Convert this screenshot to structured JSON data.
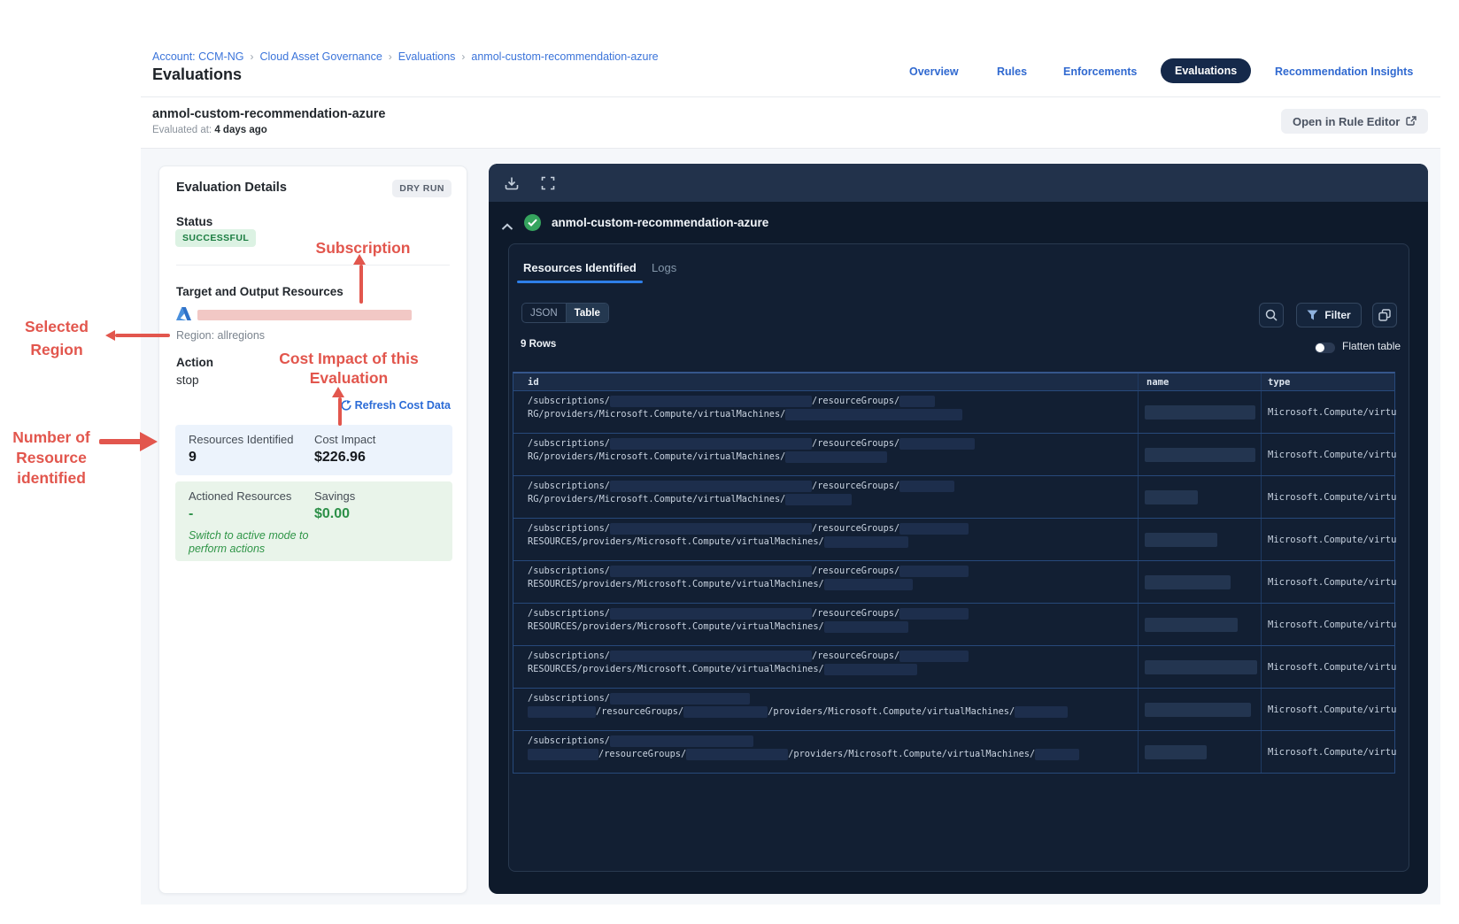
{
  "breadcrumb": {
    "items": [
      "Account: CCM-NG",
      "Cloud Asset Governance",
      "Evaluations",
      "anmol-custom-recommendation-azure"
    ],
    "separator": "›"
  },
  "page_title": "Evaluations",
  "nav": {
    "items": [
      {
        "label": "Overview"
      },
      {
        "label": "Rules"
      },
      {
        "label": "Enforcements"
      },
      {
        "label": "Evaluations",
        "active": true
      },
      {
        "label": "Recommendation Insights"
      }
    ]
  },
  "subheader": {
    "title": "anmol-custom-recommendation-azure",
    "evaluated_label": "Evaluated at:",
    "evaluated_value": "4 days ago",
    "open_button": "Open in Rule Editor"
  },
  "details": {
    "title": "Evaluation Details",
    "mode_badge": "DRY RUN",
    "status_label": "Status",
    "status_value": "SUCCESSFUL",
    "target_label": "Target and Output Resources",
    "region": "Region: allregions",
    "action_label": "Action",
    "action_value": "stop",
    "refresh_link": "Refresh Cost Data",
    "resources_identified_label": "Resources Identified",
    "resources_identified_value": "9",
    "cost_impact_label": "Cost Impact",
    "cost_impact_value": "$226.96",
    "actioned_label": "Actioned Resources",
    "actioned_value": "-",
    "savings_label": "Savings",
    "savings_value": "$0.00",
    "switch_note_line1": "Switch to active mode to",
    "switch_note_line2": "perform actions"
  },
  "annotations": {
    "color": "#e2564d",
    "subscription": "Subscription",
    "selected_region_line1": "Selected",
    "selected_region_line2": "Region",
    "cost_impact_line1": "Cost Impact of this",
    "cost_impact_line2": "Evaluation",
    "resources_line1": "Number of",
    "resources_line2": "Resource",
    "resources_line3": "identified"
  },
  "panel": {
    "title": "anmol-custom-recommendation-azure",
    "tabs": [
      {
        "label": "Resources Identified",
        "active": true
      },
      {
        "label": "Logs"
      }
    ],
    "view_toggle": {
      "json": "JSON",
      "table": "Table",
      "active": "Table"
    },
    "filter_label": "Filter",
    "rows_count": "9 Rows",
    "flatten_label": "Flatten table",
    "table": {
      "columns": [
        "id",
        "name",
        "type"
      ],
      "rows": [
        {
          "line1": [
            {
              "t": "/subscriptions/"
            },
            {
              "b": 228
            },
            {
              "t": "/resourceGroups/"
            },
            {
              "b": 40
            }
          ],
          "line2": [
            {
              "t": "RG/providers/Microsoft.Compute/virtualMachines/"
            },
            {
              "b": 200
            }
          ],
          "name_bar": 125,
          "type": "Microsoft.Compute/virtu"
        },
        {
          "line1": [
            {
              "t": "/subscriptions/"
            },
            {
              "b": 228
            },
            {
              "t": "/resourceGroups/"
            },
            {
              "b": 85
            }
          ],
          "line2": [
            {
              "t": "RG/providers/Microsoft.Compute/virtualMachines/"
            },
            {
              "b": 115
            }
          ],
          "name_bar": 125,
          "type": "Microsoft.Compute/virtu"
        },
        {
          "line1": [
            {
              "t": "/subscriptions/"
            },
            {
              "b": 228
            },
            {
              "t": "/resourceGroups/"
            },
            {
              "b": 62
            }
          ],
          "line2": [
            {
              "t": "RG/providers/Microsoft.Compute/virtualMachines/"
            },
            {
              "b": 75
            }
          ],
          "name_bar": 60,
          "type": "Microsoft.Compute/virtu"
        },
        {
          "line1": [
            {
              "t": "/subscriptions/"
            },
            {
              "b": 228
            },
            {
              "t": "/resourceGroups/"
            },
            {
              "b": 78
            }
          ],
          "line2": [
            {
              "t": "RESOURCES/providers/Microsoft.Compute/virtualMachines/"
            },
            {
              "b": 95
            }
          ],
          "name_bar": 82,
          "type": "Microsoft.Compute/virtu"
        },
        {
          "line1": [
            {
              "t": "/subscriptions/"
            },
            {
              "b": 228
            },
            {
              "t": "/resourceGroups/"
            },
            {
              "b": 78
            }
          ],
          "line2": [
            {
              "t": "RESOURCES/providers/Microsoft.Compute/virtualMachines/"
            },
            {
              "b": 100
            }
          ],
          "name_bar": 97,
          "type": "Microsoft.Compute/virtu"
        },
        {
          "line1": [
            {
              "t": "/subscriptions/"
            },
            {
              "b": 228
            },
            {
              "t": "/resourceGroups/"
            },
            {
              "b": 78
            }
          ],
          "line2": [
            {
              "t": "RESOURCES/providers/Microsoft.Compute/virtualMachines/"
            },
            {
              "b": 95
            }
          ],
          "name_bar": 105,
          "type": "Microsoft.Compute/virtu"
        },
        {
          "line1": [
            {
              "t": "/subscriptions/"
            },
            {
              "b": 228
            },
            {
              "t": "/resourceGroups/"
            },
            {
              "b": 78
            }
          ],
          "line2": [
            {
              "t": "RESOURCES/providers/Microsoft.Compute/virtualMachines/"
            },
            {
              "b": 105
            }
          ],
          "name_bar": 127,
          "type": "Microsoft.Compute/virtu"
        },
        {
          "line1": [
            {
              "t": "/subscriptions/"
            },
            {
              "b": 158
            }
          ],
          "line2": [
            {
              "b": 77
            },
            {
              "t": "/resourceGroups/"
            },
            {
              "b": 95
            },
            {
              "t": "/providers/Microsoft.Compute/virtualMachines/"
            },
            {
              "b": 60
            }
          ],
          "name_bar": 120,
          "type": "Microsoft.Compute/virtu"
        },
        {
          "line1": [
            {
              "t": "/subscriptions/"
            },
            {
              "b": 162
            }
          ],
          "line2": [
            {
              "b": 80
            },
            {
              "t": "/resourceGroups/"
            },
            {
              "b": 115
            },
            {
              "t": "/providers/Microsoft.Compute/virtualMachines/"
            },
            {
              "b": 50
            }
          ],
          "name_bar": 70,
          "type": "Microsoft.Compute/virtu"
        }
      ]
    }
  }
}
